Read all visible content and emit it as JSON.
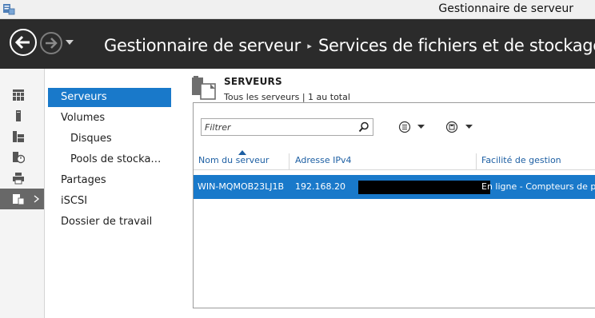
{
  "window": {
    "title": "Gestionnaire de serveur"
  },
  "header": {
    "breadcrumb": [
      "Gestionnaire de serveur",
      "Services de fichiers et de stockage"
    ]
  },
  "rail": {
    "items": [
      {
        "icon": "dashboard-icon"
      },
      {
        "icon": "local-server-icon"
      },
      {
        "icon": "all-servers-icon"
      },
      {
        "icon": "iis-icon"
      },
      {
        "icon": "print-services-icon"
      },
      {
        "icon": "file-storage-icon",
        "active": true
      }
    ]
  },
  "nav": {
    "items": [
      {
        "label": "Serveurs",
        "selected": true,
        "indent": 0
      },
      {
        "label": "Volumes",
        "indent": 0
      },
      {
        "label": "Disques",
        "indent": 1
      },
      {
        "label": "Pools de stocka…",
        "indent": 1
      },
      {
        "label": "Partages",
        "indent": 0
      },
      {
        "label": "iSCSI",
        "indent": 0
      },
      {
        "label": "Dossier de travail",
        "indent": 0
      }
    ]
  },
  "main": {
    "title": "SERVEURS",
    "subtitle": "Tous les serveurs | 1 au total",
    "filter": {
      "placeholder": "Filtrer",
      "value": ""
    },
    "columns": [
      "Nom du serveur",
      "Adresse IPv4",
      "Facilité de gestion"
    ],
    "rows": [
      {
        "name": "WIN-MQMOB23LJ1B",
        "ipv4": "192.168.20",
        "manageability": "En ligne - Compteurs de pe",
        "selected": true
      }
    ]
  },
  "colors": {
    "header_bg": "#2b2b2b",
    "selection": "#1979ca",
    "column_header_text": "#1d5fa3"
  }
}
